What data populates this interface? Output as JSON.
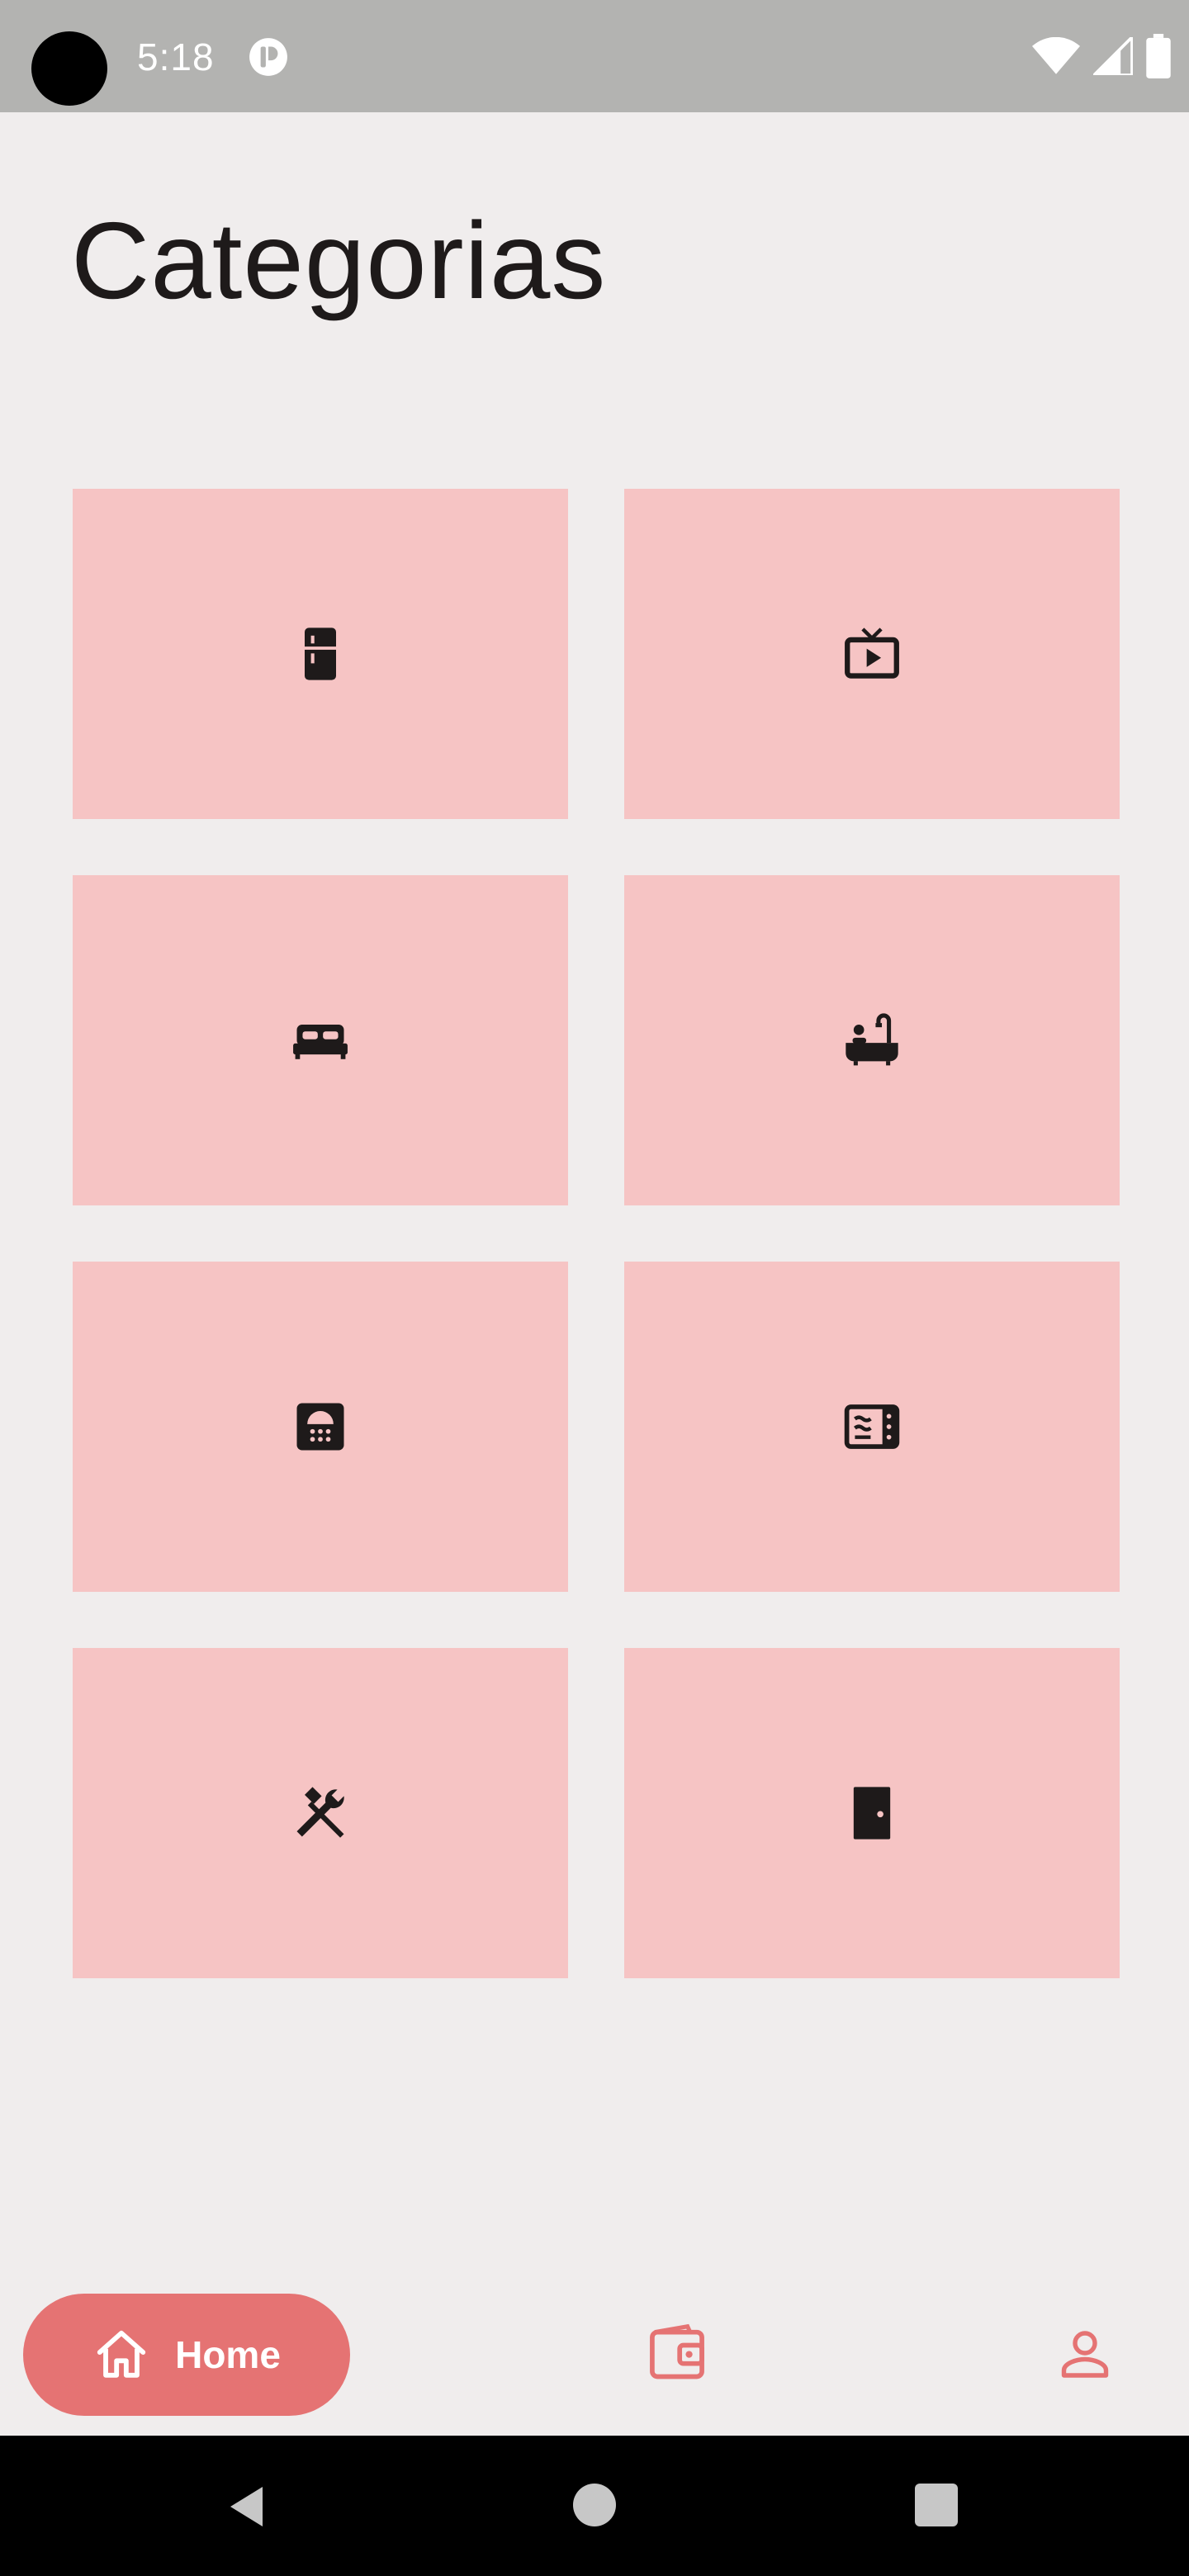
{
  "status_bar": {
    "time": "5:18",
    "icons": [
      "camera-cutout",
      "app-notification-icon",
      "wifi-icon",
      "signal-icon",
      "battery-icon"
    ]
  },
  "page": {
    "title": "Categorias"
  },
  "categories": [
    {
      "icon": "refrigerator-icon"
    },
    {
      "icon": "tv-icon"
    },
    {
      "icon": "bed-icon"
    },
    {
      "icon": "bathtub-icon"
    },
    {
      "icon": "shower-icon"
    },
    {
      "icon": "microwave-icon"
    },
    {
      "icon": "tools-icon"
    },
    {
      "icon": "door-icon"
    }
  ],
  "bottom_nav": {
    "home_label": "Home",
    "items": [
      "home-icon",
      "wallet-icon",
      "person-icon"
    ]
  },
  "colors": {
    "background": "#F0EDED",
    "tile": "#F6C4C4",
    "accent": "#E57373",
    "status_bar": "#B3B3B1",
    "icon": "#1E1A1A"
  }
}
